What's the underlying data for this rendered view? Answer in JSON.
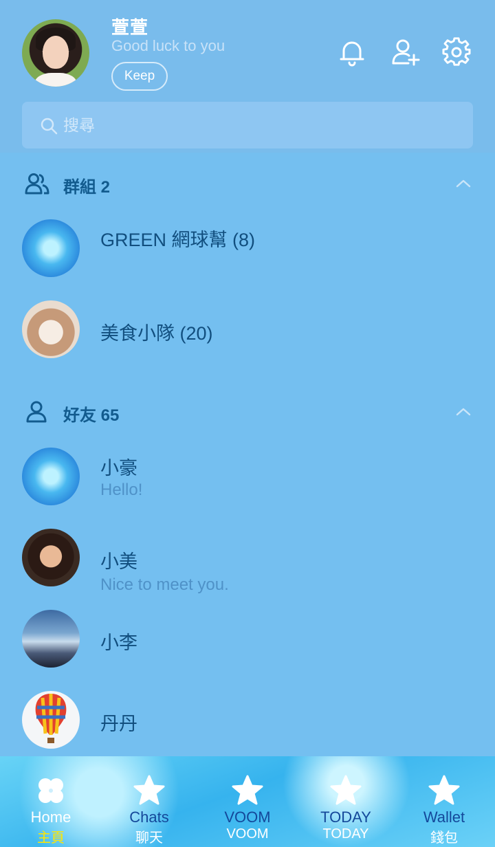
{
  "profile": {
    "name": "萱萱",
    "status": "Good luck to you",
    "keep_label": "Keep"
  },
  "header_icons": [
    "bell-icon",
    "add-friend-icon",
    "gear-icon"
  ],
  "search": {
    "placeholder": "搜尋",
    "value": ""
  },
  "groups": {
    "title": "群組 2",
    "items": [
      {
        "name": "GREEN 網球幫 (8)"
      },
      {
        "name": "美食小隊 (20)"
      }
    ]
  },
  "friends": {
    "title": "好友 65",
    "items": [
      {
        "name": "小豪",
        "message": "Hello!"
      },
      {
        "name": "小美",
        "message": "Nice to meet you."
      },
      {
        "name": "小李",
        "message": ""
      },
      {
        "name": "丹丹",
        "message": ""
      }
    ]
  },
  "nav": [
    {
      "en": "Home",
      "zh": "主頁",
      "icon": "clover-icon",
      "active": true
    },
    {
      "en": "Chats",
      "zh": "聊天",
      "icon": "star-icon",
      "active": false
    },
    {
      "en": "VOOM",
      "zh": "VOOM",
      "icon": "star-icon",
      "active": false
    },
    {
      "en": "TODAY",
      "zh": "TODAY",
      "icon": "star-icon",
      "active": false
    },
    {
      "en": "Wallet",
      "zh": "錢包",
      "icon": "star-icon",
      "active": false
    }
  ],
  "colors": {
    "background": "#74bff0",
    "header": "#79bcec",
    "text_dark": "#114e7e",
    "message_text": "#4f92c8",
    "active_nav_label": "#ffe600"
  }
}
